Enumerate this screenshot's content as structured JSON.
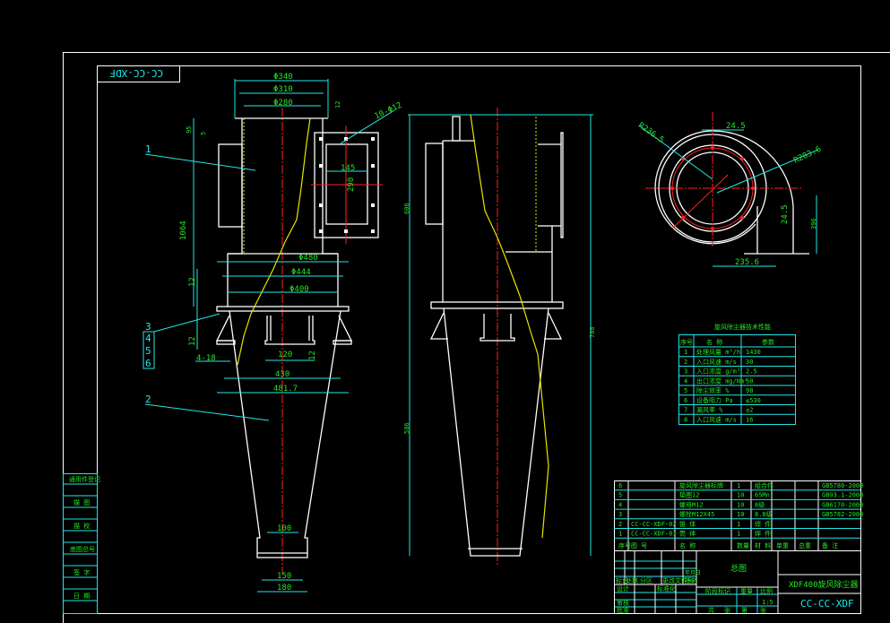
{
  "drawing": {
    "corner_code": "CC-CC-XDF",
    "colors": {
      "background": "#000000",
      "outline": "#ffffff",
      "dimension": "#22e6e6",
      "text": "#22e622",
      "centerline": "#ff2020",
      "spiral": "#e6e600"
    },
    "left_column": [
      "通用件登记",
      "描 图",
      "描 校",
      "底图总号",
      "签 字",
      "日 期"
    ],
    "part_callouts": [
      "1",
      "2",
      "3",
      "4",
      "5",
      "6"
    ],
    "dims": {
      "phi340": "Φ340",
      "phi310": "Φ310",
      "phi280": "Φ280",
      "d12a": "12",
      "d95": "95",
      "d5": "5",
      "holes": "10-Φ12",
      "d145": "145",
      "d290": "290",
      "d1064": "1064",
      "phi480": "Φ480",
      "phi444": "Φ444",
      "phi400": "Φ400",
      "d12b": "12",
      "d12c": "12",
      "holes4": "4-18",
      "d120": "120",
      "d12d": "12",
      "d430": "430",
      "d4817": "481.7",
      "d100": "100",
      "d150": "150",
      "d180": "180",
      "r2365": "R236.5",
      "r2836": "R283.6",
      "d245a": "24.5",
      "d245b": "24.5",
      "d2356": "235.6",
      "d396": "396",
      "side_h1": "606",
      "side_h2": "708",
      "side_h3": "506"
    },
    "param_table": {
      "title": "旋风除尘器技术性能",
      "headers": [
        "序号",
        "名 称",
        "参数"
      ],
      "rows": [
        [
          "1",
          "处理风量 m³/h",
          "1430"
        ],
        [
          "2",
          "入口风速 m/s",
          "30"
        ],
        [
          "3",
          "入口浓度 g/m³",
          "2.5"
        ],
        [
          "4",
          "出口浓度 mg/Nm³",
          "50"
        ],
        [
          "5",
          "除尘效率 %",
          "98"
        ],
        [
          "6",
          "设备阻力 Pa",
          "≤530"
        ],
        [
          "7",
          "漏风率 %",
          "≤2"
        ],
        [
          "8",
          "入口风速 m/s",
          "16"
        ]
      ]
    },
    "bom": {
      "headers": [
        "序号",
        "图 号",
        "名 称",
        "数量",
        "材 料",
        "单重",
        "总重",
        "备 注"
      ],
      "rows": [
        [
          "6",
          "",
          "旋风除尘器标牌",
          "1",
          "组合件",
          "",
          "",
          "GB5780-2000"
        ],
        [
          "5",
          "",
          "垫圈12",
          "10",
          "65Mn",
          "",
          "",
          "GB93.1-2000"
        ],
        [
          "4",
          "",
          "螺母M12",
          "10",
          "8级",
          "",
          "",
          "GB6170-2000"
        ],
        [
          "3",
          "",
          "螺栓M12X45",
          "10",
          "8.8级",
          "",
          "",
          "GB5782-2000"
        ],
        [
          "2",
          "CC-CC-XDF-02",
          "锥 体",
          "1",
          "焊 件",
          "",
          "",
          ""
        ],
        [
          "1",
          "CC-CC-XDF-01",
          "筒 体",
          "1",
          "焊 件",
          "",
          "",
          ""
        ]
      ]
    },
    "title_block": {
      "drawing_name": "总图",
      "product_name": "XDF400旋风除尘器",
      "drawing_number": "CC-CC-XDF",
      "labels": [
        "标记",
        "处数",
        "分区",
        "更改文件号",
        "签名",
        "年月日",
        "设计",
        "标准化",
        "审核",
        "工艺",
        "批准",
        "阶段标记",
        "重量",
        "比例",
        "共",
        "张",
        "第",
        "张"
      ],
      "scale": "1:5"
    }
  }
}
